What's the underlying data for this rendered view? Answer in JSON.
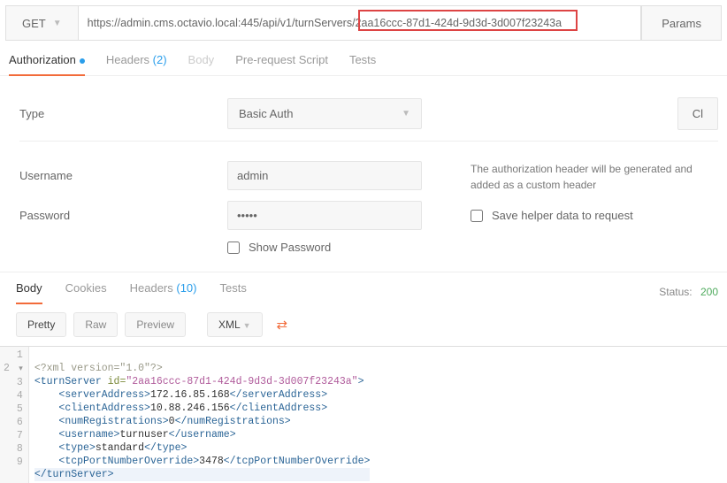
{
  "request": {
    "method": "GET",
    "url": "https://admin.cms.octavio.local:445/api/v1/turnServers/2aa16ccc-87d1-424d-9d3d-3d007f23243a",
    "params_btn": "Params"
  },
  "tabs_req": {
    "authorization": "Authorization",
    "headers": "Headers",
    "headers_count": "(2)",
    "body": "Body",
    "prerequest": "Pre-request Script",
    "tests": "Tests"
  },
  "auth": {
    "type_label": "Type",
    "type_value": "Basic Auth",
    "clear_btn": "Cl",
    "username_label": "Username",
    "username_value": "admin",
    "password_label": "Password",
    "password_value": "•••••",
    "show_password": "Show Password",
    "helper_text": "The authorization header will be generated and added as a custom header",
    "save_helper": "Save helper data to request"
  },
  "tabs_resp": {
    "body": "Body",
    "cookies": "Cookies",
    "headers": "Headers",
    "headers_count": "(10)",
    "tests": "Tests",
    "status_label": "Status:",
    "status_code": "200"
  },
  "toolbar": {
    "pretty": "Pretty",
    "raw": "Raw",
    "preview": "Preview",
    "lang": "XML"
  },
  "xml": {
    "l1": "<?xml version=\"1.0\"?>",
    "l2_open": "<turnServer",
    "l2_attr": " id=",
    "l2_val": "\"2aa16ccc-87d1-424d-9d3d-3d007f23243a\"",
    "l2_close": ">",
    "l3_tag": "serverAddress",
    "l3_text": "172.16.85.168",
    "l4_tag": "clientAddress",
    "l4_text": "10.88.246.156",
    "l5_tag": "numRegistrations",
    "l5_text": "0",
    "l6_tag": "username",
    "l6_text": "turnuser",
    "l7_tag": "type",
    "l7_text": "standard",
    "l8_tag": "tcpPortNumberOverride",
    "l8_text": "3478",
    "l9_tag": "</turnServer>"
  }
}
